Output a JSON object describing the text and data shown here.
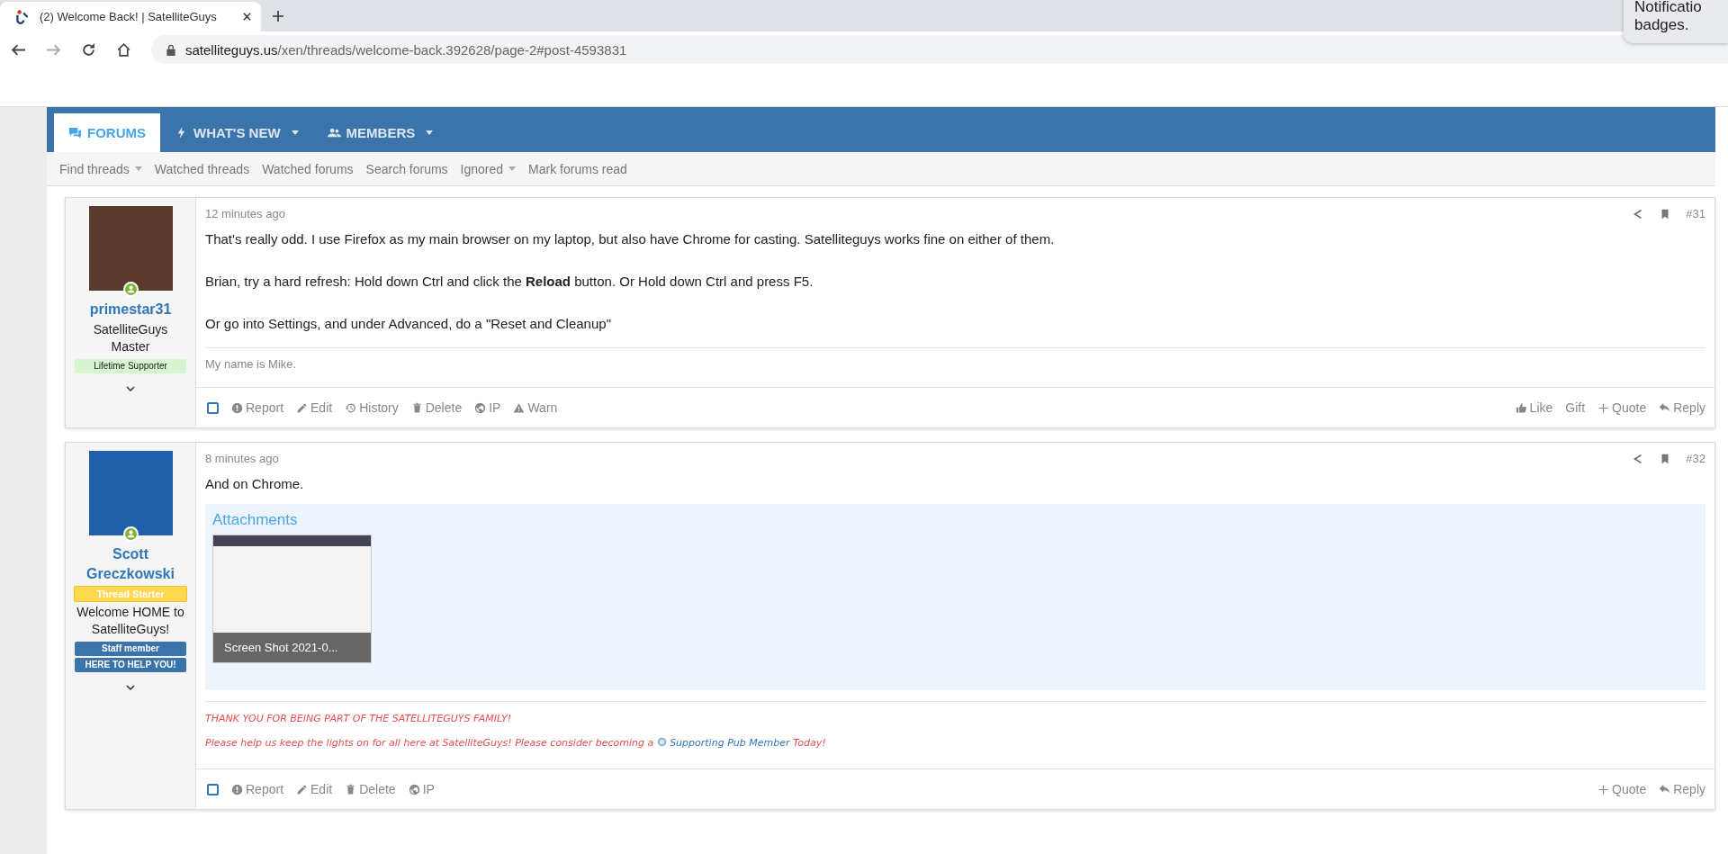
{
  "browser": {
    "tab_title": "(2) Welcome Back! | SatelliteGuys",
    "url_host": "satelliteguys.us",
    "url_path": "/xen/threads/welcome-back.392628/page-2#post-4593831",
    "notification_lines": [
      "Notificatio",
      "badges."
    ]
  },
  "nav": {
    "tabs": [
      {
        "label": "FORUMS",
        "kind": "forums",
        "selected": true,
        "dropdown": false
      },
      {
        "label": "WHAT'S NEW",
        "kind": "bolt",
        "selected": false,
        "dropdown": true
      },
      {
        "label": "MEMBERS",
        "kind": "users",
        "selected": false,
        "dropdown": true
      }
    ],
    "sub_links": [
      {
        "label": "Find threads",
        "dropdown": true
      },
      {
        "label": "Watched threads",
        "dropdown": false
      },
      {
        "label": "Watched forums",
        "dropdown": false
      },
      {
        "label": "Search forums",
        "dropdown": false
      },
      {
        "label": "Ignored",
        "dropdown": true
      },
      {
        "label": "Mark forums read",
        "dropdown": false
      }
    ]
  },
  "posts": [
    {
      "user": {
        "name_lines": [
          "primestar31"
        ],
        "title_lines": [
          "SatelliteGuys",
          "Master"
        ],
        "online": true,
        "badges_after": [
          {
            "label": "Lifetime Supporter",
            "kind": "supporter"
          }
        ]
      },
      "time": "12 minutes ago",
      "number": "#31",
      "paragraphs": [
        "That's really odd. I use Firefox as my main browser on my laptop, but also have Chrome for casting. Satelliteguys works fine on either of them.",
        "Brian, try a hard refresh: Hold down Ctrl and click the **Reload** button. Or Hold down Ctrl and press F5.",
        "Or go into Settings, and under Advanced, do a \"Reset and Cleanup\""
      ],
      "signature": {
        "kind": "plain",
        "lines": [
          "My name is Mike."
        ]
      },
      "selected": false,
      "actions_left": [
        {
          "label": "Report",
          "kind": "report"
        },
        {
          "label": "Edit",
          "kind": "edit"
        },
        {
          "label": "History",
          "kind": "history"
        },
        {
          "label": "Delete",
          "kind": "delete"
        },
        {
          "label": "IP",
          "kind": "ip"
        },
        {
          "label": "Warn",
          "kind": "warn"
        }
      ],
      "actions_right": [
        {
          "label": "Like",
          "kind": "like"
        },
        {
          "label": "Gift",
          "kind": "gift"
        },
        {
          "label": "Quote",
          "kind": "quote"
        },
        {
          "label": "Reply",
          "kind": "reply"
        }
      ]
    },
    {
      "user": {
        "name_lines": [
          "Scott",
          "Greczkowski"
        ],
        "title_lines": [
          "Welcome HOME to",
          "SatelliteGuys!"
        ],
        "online": true,
        "badges": [
          {
            "label": "Thread Starter",
            "kind": "starter"
          }
        ],
        "badges_after": [
          {
            "label": "Staff member",
            "kind": "staff"
          },
          {
            "label": "HERE TO HELP YOU!",
            "kind": "staff"
          }
        ]
      },
      "time": "8 minutes ago",
      "number": "#32",
      "paragraphs": [
        "And on Chrome."
      ],
      "attachments": {
        "title": "Attachments",
        "items": [
          {
            "caption": "Screen Shot 2021-0..."
          }
        ]
      },
      "signature": {
        "kind": "promo",
        "lines": [
          "THANK YOU FOR BEING PART OF THE SATELLITEGUYS FAMILY!"
        ],
        "promo": {
          "before": "Please help us keep the lights on for all here at SatelliteGuys! Please consider becoming a",
          "link": "Supporting Pub Member",
          "after": "Today!"
        }
      },
      "selected": false,
      "actions_left": [
        {
          "label": "Report",
          "kind": "report"
        },
        {
          "label": "Edit",
          "kind": "edit"
        },
        {
          "label": "Delete",
          "kind": "delete"
        },
        {
          "label": "IP",
          "kind": "ip"
        }
      ],
      "actions_right": [
        {
          "label": "Quote",
          "kind": "quote"
        },
        {
          "label": "Reply",
          "kind": "reply"
        }
      ]
    }
  ]
}
